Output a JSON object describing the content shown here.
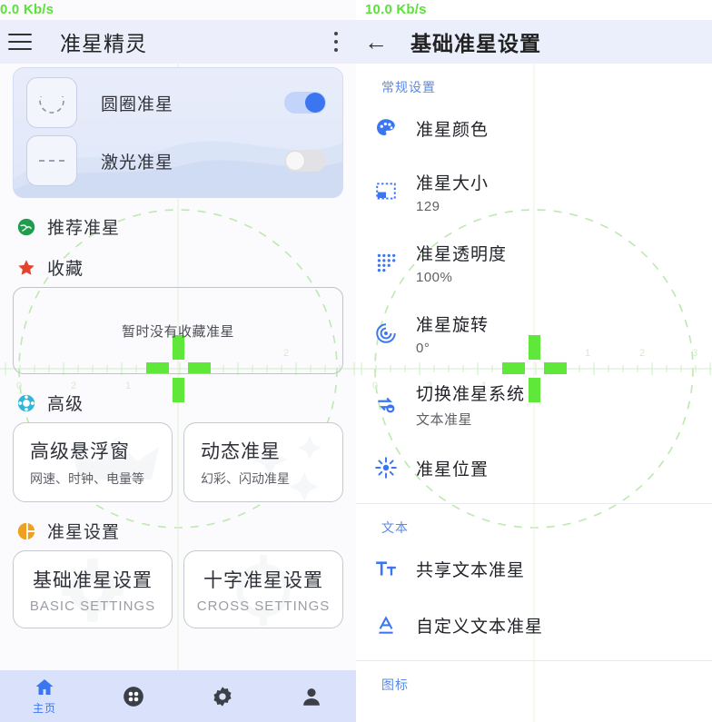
{
  "left": {
    "netspeed": "0.0 Kb/s",
    "appbar": {
      "menu_icon": "hamburger-menu-icon",
      "title": "准星精灵",
      "overflow_icon": "kebab-menu-icon"
    },
    "crosshair_cards": [
      {
        "label": "圆圈准星",
        "thumb_icon": "dashed-circle-icon",
        "toggle": "on"
      },
      {
        "label": "激光准星",
        "thumb_icon": "dashed-line-icon",
        "toggle": "off"
      }
    ],
    "sections": [
      {
        "icon": "globe-icon",
        "label": "推荐准星"
      },
      {
        "icon": "star-icon",
        "label": "收藏"
      },
      {
        "icon": "advanced-control-icon",
        "label": "高级"
      },
      {
        "icon": "pie-icon",
        "label": "准星设置"
      }
    ],
    "favorites_empty": "暂时没有收藏准星",
    "advanced_cards": [
      {
        "title": "高级悬浮窗",
        "subtitle": "网速、时钟、电量等",
        "ghost_icon": "crown-icon"
      },
      {
        "title": "动态准星",
        "subtitle": "幻彩、闪动准星",
        "ghost_icon": "sparkle-icon"
      }
    ],
    "settings_cards": [
      {
        "title": "基础准星设置",
        "subtitle": "BASIC SETTINGS",
        "ghost_icon": "gear-icon"
      },
      {
        "title": "十字准星设置",
        "subtitle": "CROSS SETTINGS",
        "ghost_icon": "crosshair-icon"
      }
    ],
    "bottom_nav": [
      {
        "icon": "home-icon",
        "label": "主页",
        "selected": true
      },
      {
        "icon": "game-disc-icon",
        "label": "",
        "selected": false
      },
      {
        "icon": "gear-icon",
        "label": "",
        "selected": false
      },
      {
        "icon": "person-icon",
        "label": "",
        "selected": false
      }
    ]
  },
  "right": {
    "netspeed": "10.0 Kb/s",
    "appbar": {
      "back_icon": "back-arrow-icon",
      "title": "基础准星设置"
    },
    "groups": [
      {
        "name": "常规设置",
        "items": [
          {
            "icon": "palette-icon",
            "title": "准星颜色",
            "value": ""
          },
          {
            "icon": "resize-box-icon",
            "title": "准星大小",
            "value": "129"
          },
          {
            "icon": "dot-grid-icon",
            "title": "准星透明度",
            "value": "100%"
          },
          {
            "icon": "target-spiral-icon",
            "title": "准星旋转",
            "value": "0°"
          },
          {
            "icon": "swap-arrows-icon",
            "title": "切换准星系统",
            "value": "文本准星"
          },
          {
            "icon": "sunburst-icon",
            "title": "准星位置",
            "value": ""
          }
        ]
      },
      {
        "name": "文本",
        "items": [
          {
            "icon": "text-format-icon",
            "title": "共享文本准星",
            "value": ""
          },
          {
            "icon": "letter-a-icon",
            "title": "自定义文本准星",
            "value": ""
          }
        ]
      },
      {
        "name": "图标",
        "items": []
      }
    ]
  },
  "colors": {
    "crosshair_green": "#5fe83a",
    "guide_green": "#bde8b0",
    "accent_blue": "#3b76f0",
    "group_label_blue": "#5a8ae8",
    "appbar_bg": "#eceefb",
    "netspeed_green": "#5ce03c"
  }
}
